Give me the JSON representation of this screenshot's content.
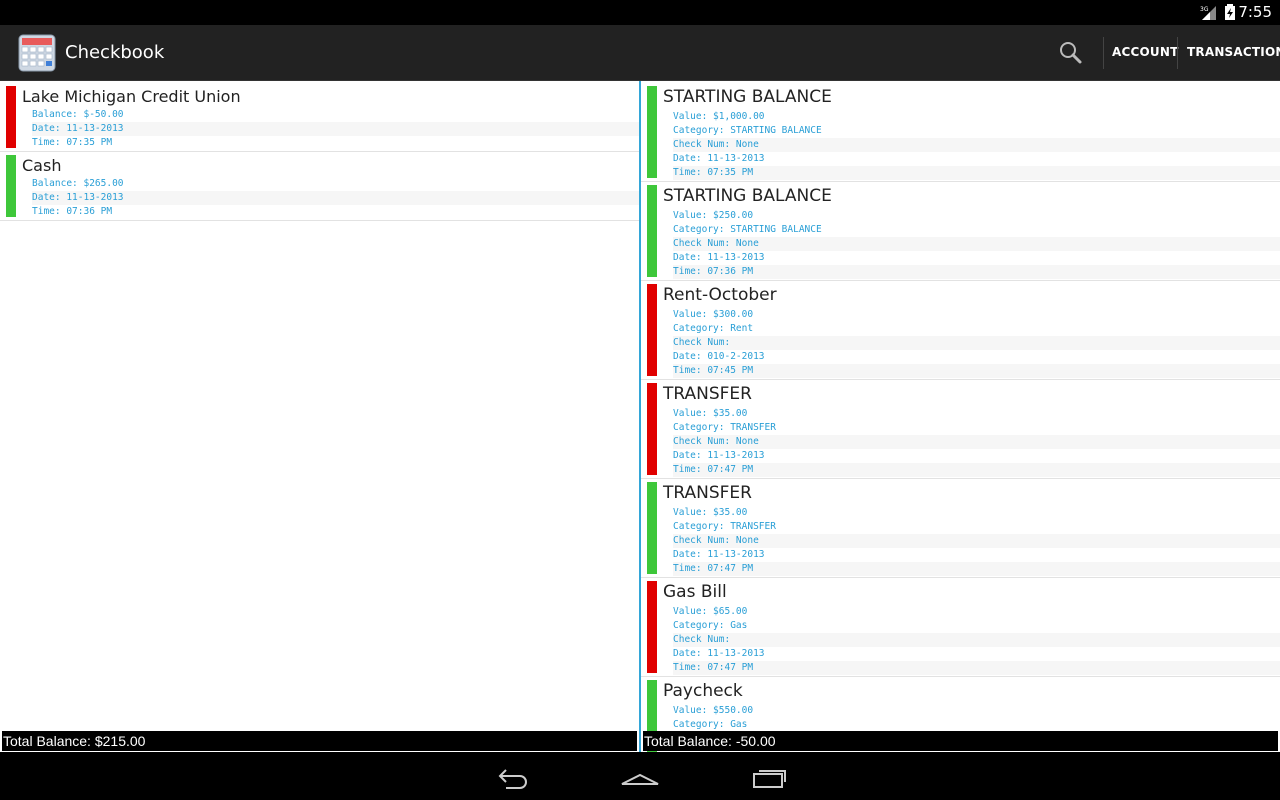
{
  "status_bar": {
    "time": "7:55",
    "network": "3G",
    "icons": [
      "signal-icon",
      "battery-icon"
    ]
  },
  "action_bar": {
    "title": "Checkbook",
    "search_icon": "search-icon",
    "account_label": "ACCOUNT",
    "transaction_label": "TRANSACTION"
  },
  "colors": {
    "positive": "#3ec73a",
    "negative": "#e00000",
    "detail_text": "#2a9fd6",
    "splitter": "#33a6d8"
  },
  "accounts": {
    "items": [
      {
        "name": "Lake Michigan Credit Union",
        "status": "negative",
        "balance": "Balance: $-50.00",
        "date": "Date: 11-13-2013",
        "time": "Time: 07:35 PM"
      },
      {
        "name": "Cash",
        "status": "positive",
        "balance": "Balance: $265.00",
        "date": "Date: 11-13-2013",
        "time": "Time: 07:36 PM"
      }
    ],
    "total": "Total Balance: $215.00"
  },
  "transactions": {
    "items": [
      {
        "name": "STARTING BALANCE",
        "status": "positive",
        "value": "Value: $1,000.00",
        "category": "Category: STARTING BALANCE",
        "check_num": "Check Num: None",
        "date": "Date: 11-13-2013",
        "time": "Time: 07:35 PM"
      },
      {
        "name": "STARTING BALANCE",
        "status": "positive",
        "value": "Value: $250.00",
        "category": "Category: STARTING BALANCE",
        "check_num": "Check Num: None",
        "date": "Date: 11-13-2013",
        "time": "Time: 07:36 PM"
      },
      {
        "name": "Rent-October",
        "status": "negative",
        "value": "Value: $300.00",
        "category": "Category: Rent",
        "check_num": "Check Num:",
        "date": "Date: 010-2-2013",
        "time": "Time: 07:45 PM"
      },
      {
        "name": "TRANSFER",
        "status": "negative",
        "value": "Value: $35.00",
        "category": "Category: TRANSFER",
        "check_num": "Check Num: None",
        "date": "Date: 11-13-2013",
        "time": "Time: 07:47 PM"
      },
      {
        "name": "TRANSFER",
        "status": "positive",
        "value": "Value: $35.00",
        "category": "Category: TRANSFER",
        "check_num": "Check Num: None",
        "date": "Date: 11-13-2013",
        "time": "Time: 07:47 PM"
      },
      {
        "name": "Gas Bill",
        "status": "negative",
        "value": "Value: $65.00",
        "category": "Category: Gas",
        "check_num": "Check Num:",
        "date": "Date: 11-13-2013",
        "time": "Time: 07:47 PM"
      },
      {
        "name": "Paycheck",
        "status": "positive",
        "value": "Value: $550.00",
        "category": "Category: Gas"
      }
    ],
    "total": "Total Balance: -50.00"
  },
  "nav_bar": {
    "icons": [
      "back-icon",
      "home-icon",
      "recent-apps-icon"
    ]
  }
}
